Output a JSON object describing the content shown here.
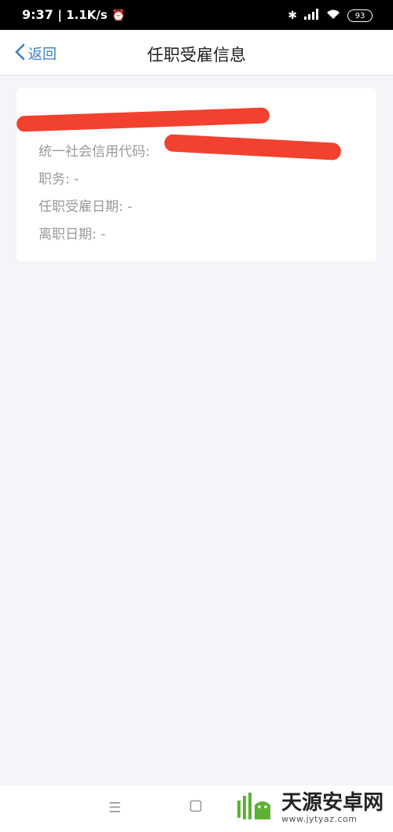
{
  "status_bar": {
    "time": "9:37",
    "rate": "1.1K/s",
    "battery": "93"
  },
  "header": {
    "back_label": "返回",
    "title": "任职受雇信息"
  },
  "card": {
    "name": "",
    "credit_code_label": "统一社会信用代码:",
    "position_label": "职务: -",
    "employment_date_label": "任职受雇日期: -",
    "leave_date_label": "离职日期: -"
  },
  "bottom_nav": {
    "menu_icon": "menu-icon",
    "home_icon": "home-square-icon"
  },
  "watermark": {
    "title": "天源安卓网",
    "url": "www.jytyaz.com"
  },
  "colors": {
    "accent": "#3b82c4",
    "redaction": "#f2412f",
    "background": "#f4f4f9"
  }
}
